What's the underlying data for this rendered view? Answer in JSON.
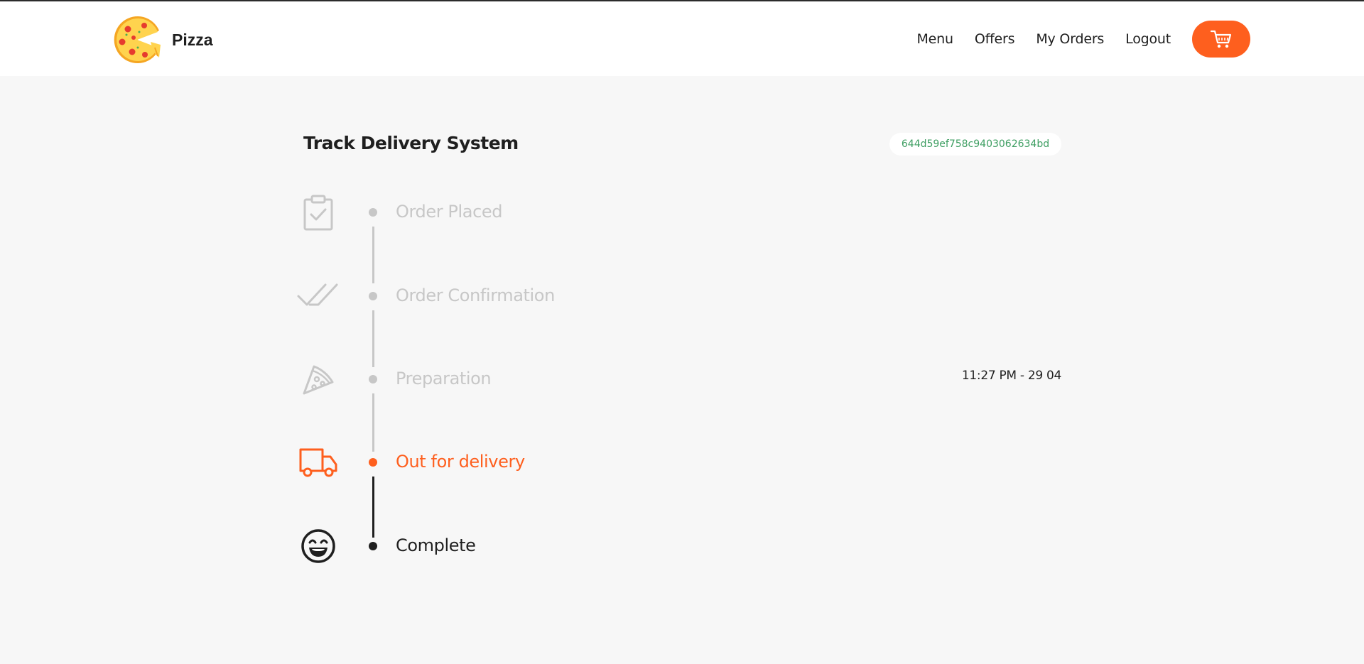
{
  "header": {
    "brand": "Pizza",
    "nav": [
      "Menu",
      "Offers",
      "My Orders",
      "Logout"
    ]
  },
  "page": {
    "title": "Track Delivery System",
    "order_id": "644d59ef758c9403062634bd",
    "time": "11:27 PM - 29 04"
  },
  "steps": [
    {
      "label": "Order Placed",
      "icon": "clipboard-check-icon",
      "state": "done"
    },
    {
      "label": "Order Confirmation",
      "icon": "double-check-icon",
      "state": "done"
    },
    {
      "label": "Preparation",
      "icon": "pizza-slice-icon",
      "state": "done"
    },
    {
      "label": "Out for delivery",
      "icon": "truck-icon",
      "state": "current"
    },
    {
      "label": "Complete",
      "icon": "smile-icon",
      "state": "pending"
    }
  ],
  "colors": {
    "accent": "#fe5f1e",
    "done": "#c7c7c7",
    "pending": "#1f1f1f",
    "order_id_text": "#3e9e62"
  }
}
